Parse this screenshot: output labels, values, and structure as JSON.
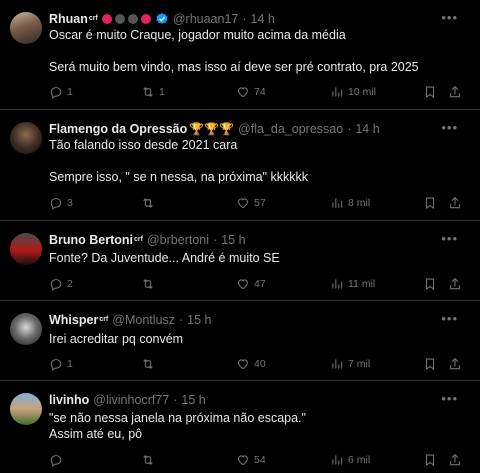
{
  "tweets": [
    {
      "name": "Rhuan",
      "sup": "crf",
      "handle": "@rhuaan17",
      "dot": "·",
      "time": "14 h",
      "text": "Oscar é muito Craque, jogador muito acima da média\n\nSerá muito bem vindo, mas isso aí deve ser pré contrato, pra 2025",
      "replies": "1",
      "retweets": "1",
      "likes": "74",
      "views": "10 mil"
    },
    {
      "name": "Flamengo da Opressão",
      "trophies": "🏆🏆🏆",
      "handle": "@fla_da_opressao",
      "dot": "·",
      "time": "14 h",
      "text": "Tão falando isso desde 2021 cara\n\nSempre isso, \" se n nessa, na próxima\" kkkkkk",
      "replies": "3",
      "retweets": "",
      "likes": "57",
      "views": "8 mil"
    },
    {
      "name": "Bruno Bertoni",
      "sup": "crf",
      "handle": "@brbertoni",
      "dot": "·",
      "time": "15 h",
      "text": "Fonte? Da Juventude... André é muito SE",
      "replies": "2",
      "retweets": "",
      "likes": "47",
      "views": "11 mil"
    },
    {
      "name": "Whisper",
      "sup": "crf",
      "handle": "@Montlusz",
      "dot": "·",
      "time": "15 h",
      "text": "Irei acreditar pq convém",
      "replies": "1",
      "retweets": "",
      "likes": "40",
      "views": "7 mil"
    },
    {
      "name": "livinho",
      "handle": "@livinhocrf77",
      "dot": "·",
      "time": "15 h",
      "text": "\"se não nessa janela na próxima não escapa.\"\nAssim até eu, pô",
      "replies": "",
      "retweets": "",
      "likes": "54",
      "views": "6 mil"
    }
  ],
  "colors": {
    "verified": "#1d9bf0",
    "badge_red": "#e0245e",
    "badge_gray": "#555555",
    "muted": "#71767b",
    "separator": "#2f3336"
  },
  "icons": [
    "reply-icon",
    "retweet-icon",
    "like-icon",
    "views-icon",
    "bookmark-icon",
    "share-icon",
    "more-icon",
    "verified-icon"
  ]
}
